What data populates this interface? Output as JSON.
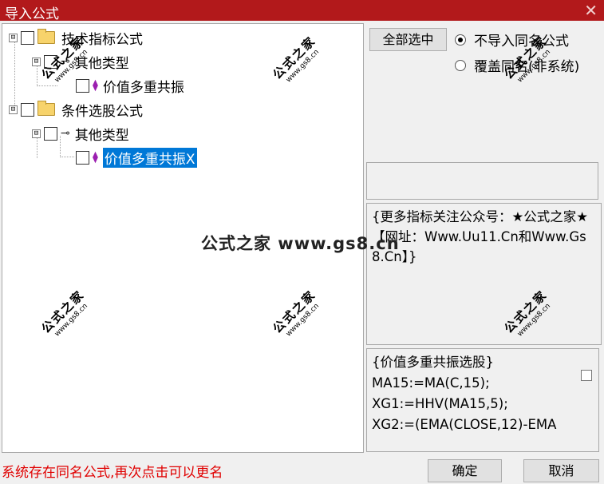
{
  "window": {
    "title": "导入公式",
    "close_glyph": "✕"
  },
  "tree": {
    "nodes": [
      {
        "label": "技术指标公式",
        "expander": "⊟"
      },
      {
        "label": "其他类型",
        "expander": "⊟"
      },
      {
        "label": "价值多重共振"
      },
      {
        "label": "条件选股公式",
        "expander": "⊟"
      },
      {
        "label": "其他类型",
        "expander": "⊟"
      },
      {
        "label": "价值多重共振X",
        "selected": true
      }
    ]
  },
  "buttons": {
    "select_all": "全部选中",
    "ok": "确定",
    "cancel": "取消"
  },
  "options": {
    "no_import": "不导入同名公式",
    "overwrite": "覆盖同名(非系统)",
    "selected": "no_import"
  },
  "info_text": "{更多指标关注公众号：★公式之家★ 【网址：Www.Uu11.Cn和Www.Gs8.Cn】}",
  "formula_lines": [
    "{价值多重共振选股}",
    "MA15:=MA(C,15);",
    "XG1:=HHV(MA15,5);",
    "XG2:=(EMA(CLOSE,12)-EMA"
  ],
  "status_message": "系统存在同名公式,再次点击可以更名",
  "watermark": {
    "cn": "公式之家",
    "url": "www.gs8.cn",
    "center": "公式之家 www.gs8.cn"
  },
  "colors": {
    "title_bar": "#b2191b",
    "selection": "#0078d7",
    "status": "#e00000",
    "gem": "#9b1fb0"
  }
}
